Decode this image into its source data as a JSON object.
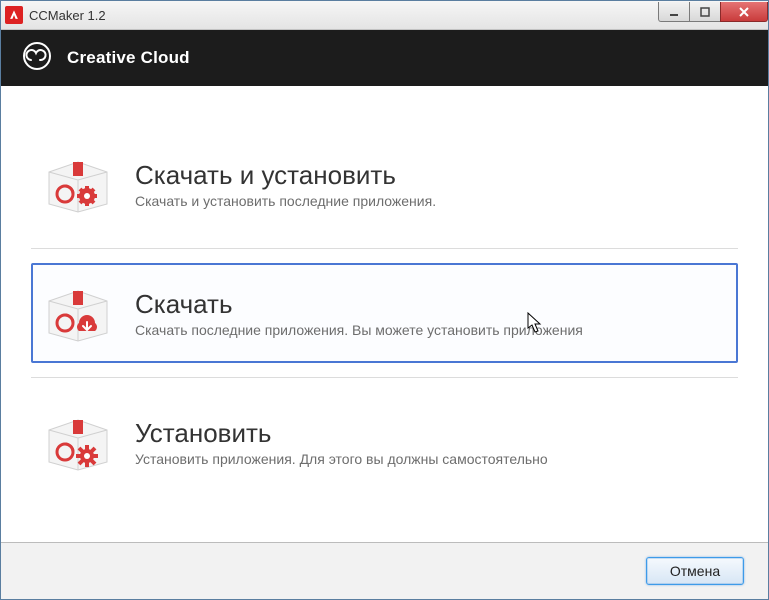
{
  "window": {
    "title": "CCMaker 1.2"
  },
  "header": {
    "title": "Creative Cloud"
  },
  "options": [
    {
      "title": "Скачать и установить",
      "desc": "Скачать и установить последние приложения.",
      "selected": false,
      "overlay": "gear"
    },
    {
      "title": "Скачать",
      "desc": "Скачать последние приложения. Вы можете установить приложения",
      "selected": true,
      "overlay": "download"
    },
    {
      "title": "Установить",
      "desc": "Установить приложения. Для этого вы должны самостоятельно",
      "selected": false,
      "overlay": "cog"
    }
  ],
  "footer": {
    "cancel": "Отмена"
  }
}
